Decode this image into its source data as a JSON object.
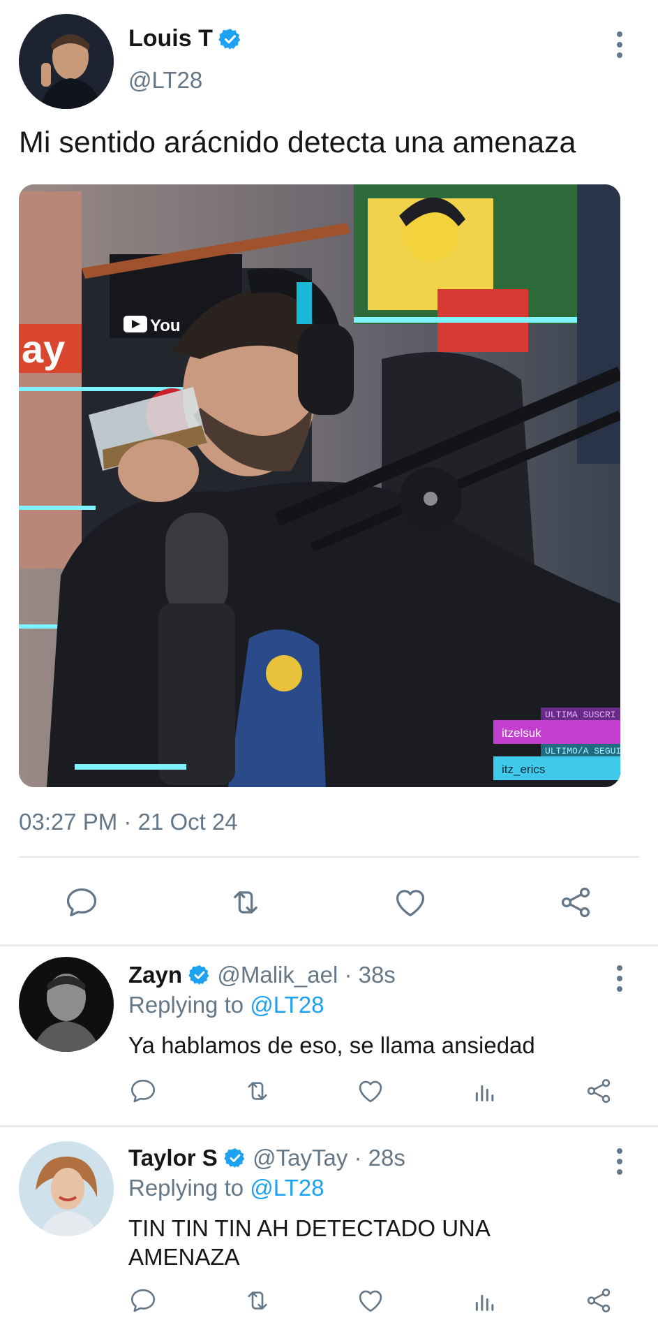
{
  "main_tweet": {
    "name": "Louis T",
    "handle": "@LT28",
    "text": "Mi sentido arácnido detecta una amenaza",
    "timestamp": "03:27 PM · 21 Oct 24",
    "media_overlay": {
      "label_top": "ULTIMA SUSCRI",
      "user_top": "itzelsuk",
      "label_bottom": "ULTIMO/A SEGUI",
      "user_bottom": "itz_erics",
      "youtube_text": "You",
      "side_text": "ay"
    },
    "actions": [
      "reply-icon",
      "retweet-icon",
      "like-icon",
      "share-icon"
    ]
  },
  "replies": [
    {
      "name": "Zayn",
      "handle": "@Malik_ael · 38s",
      "replying_prefix": "Replying to ",
      "replying_to": "@LT28",
      "text": "Ya hablamos de eso, se llama ansiedad"
    },
    {
      "name": "Taylor S",
      "handle": "@TayTay · 28s",
      "replying_prefix": "Replying to ",
      "replying_to": "@LT28",
      "text": "TIN TIN TIN AH DETECTADO UNA AMENAZA"
    }
  ],
  "colors": {
    "accent": "#1da1f2",
    "muted": "#657786",
    "text": "#14171a",
    "verified": "#1da1f2"
  }
}
